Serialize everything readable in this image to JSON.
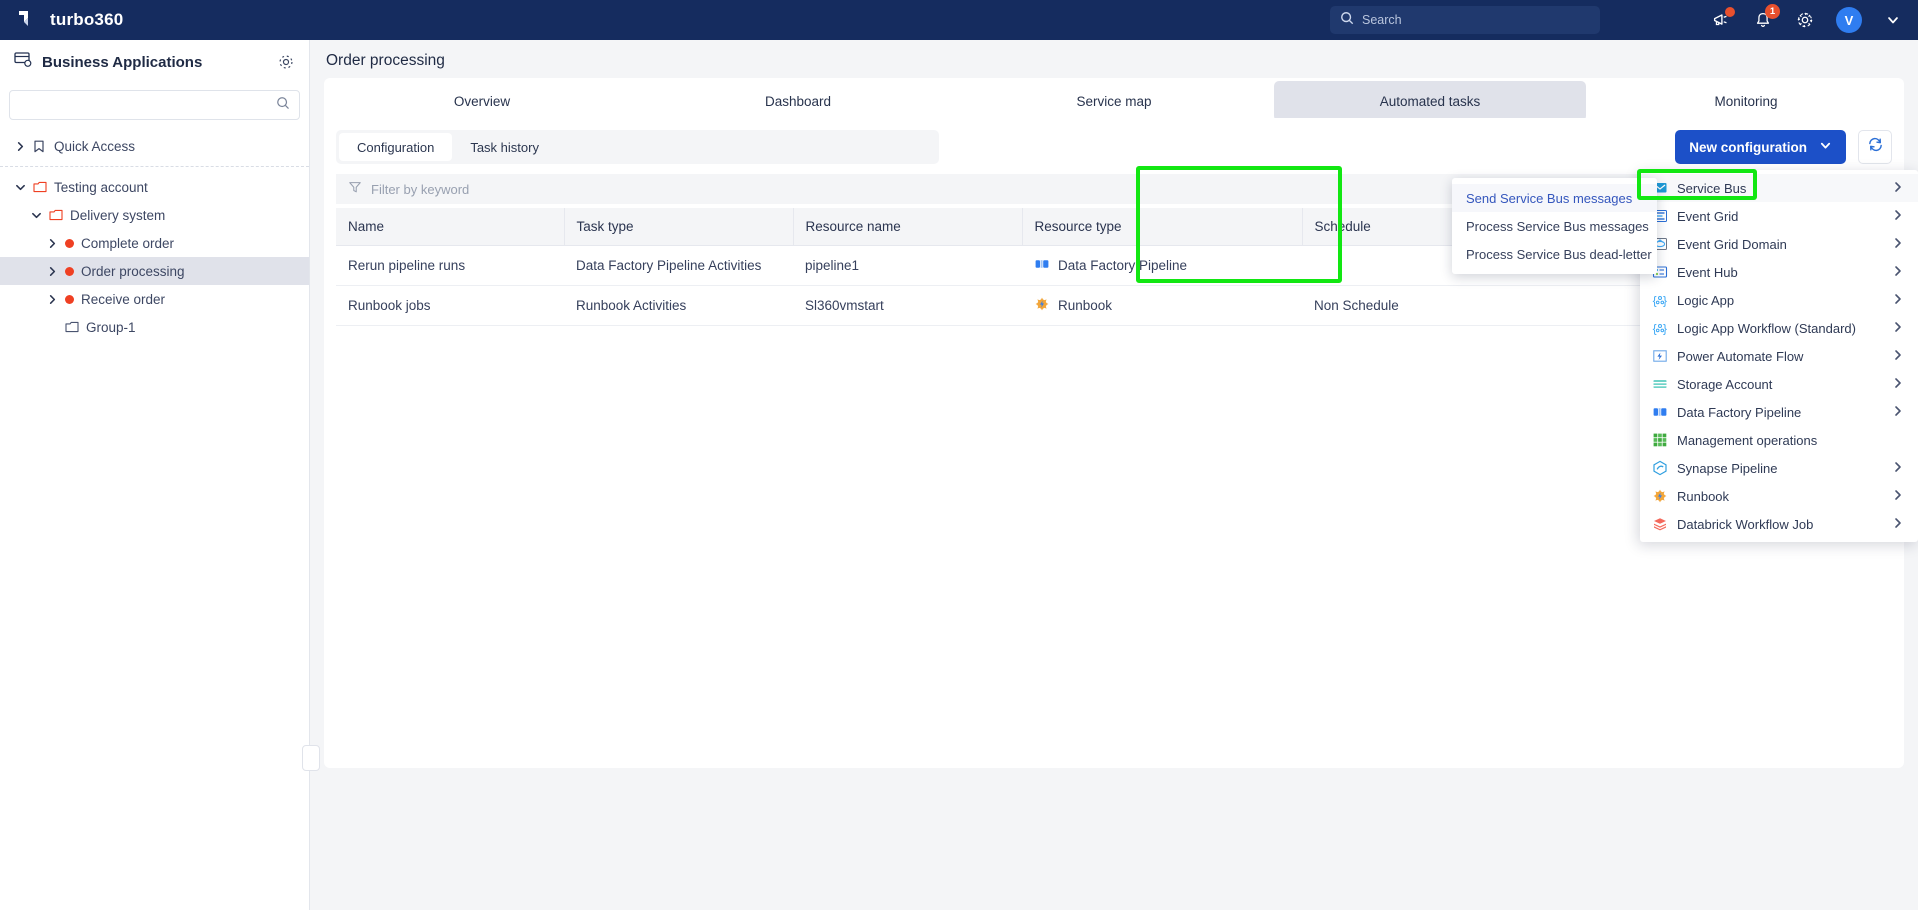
{
  "topbar": {
    "brand": "turbo360",
    "search_placeholder": "Search",
    "search_value": "",
    "icons": {
      "announce": "megaphone-icon",
      "bell": "bell-icon",
      "gear": "gear-icon"
    },
    "notification_count": "1",
    "avatar_initial": "V"
  },
  "sidebar": {
    "title": "Business Applications",
    "search_placeholder": "",
    "search_value": "",
    "tree": [
      {
        "label": "Quick Access",
        "icon": "bookmark-icon",
        "depth": 0,
        "chevron": "right",
        "selected": false
      },
      {
        "label": "Testing account",
        "icon": "folder-icon",
        "depth": 0,
        "chevron": "down",
        "selected": false
      },
      {
        "label": "Delivery system",
        "icon": "folder-icon",
        "depth": 1,
        "chevron": "down",
        "selected": false
      },
      {
        "label": "Complete order",
        "icon": "status-dot",
        "depth": 2,
        "chevron": "right",
        "selected": false
      },
      {
        "label": "Order processing",
        "icon": "status-dot",
        "depth": 2,
        "chevron": "right",
        "selected": true
      },
      {
        "label": "Receive order",
        "icon": "status-dot",
        "depth": 2,
        "chevron": "right",
        "selected": false
      },
      {
        "label": "Group-1",
        "icon": "folder-icon",
        "depth": 2,
        "chevron": "none",
        "selected": false
      }
    ]
  },
  "main": {
    "page_title": "Order processing",
    "tabs": [
      {
        "label": "Overview",
        "active": false
      },
      {
        "label": "Dashboard",
        "active": false
      },
      {
        "label": "Service map",
        "active": false
      },
      {
        "label": "Automated tasks",
        "active": true
      },
      {
        "label": "Monitoring",
        "active": false
      }
    ],
    "subtabs": [
      {
        "label": "Configuration",
        "active": true
      },
      {
        "label": "Task history",
        "active": false
      }
    ],
    "new_configuration_label": "New configuration",
    "refresh_icon": "refresh-icon",
    "filter_placeholder": "Filter by keyword",
    "table": {
      "columns": [
        "Name",
        "Task type",
        "Resource name",
        "Resource type",
        "Schedule"
      ],
      "rows": [
        {
          "name": "Rerun pipeline runs",
          "task_type": "Data Factory Pipeline Activities",
          "resource_name": "pipeline1",
          "resource_type": "Data Factory Pipeline",
          "resource_icon": "data-factory-pipeline-icon",
          "schedule": ""
        },
        {
          "name": "Runbook jobs",
          "task_type": "Runbook Activities",
          "resource_name": "Sl360vmstart",
          "resource_type": "Runbook",
          "resource_icon": "runbook-icon",
          "schedule": "Non Schedule"
        }
      ]
    }
  },
  "context_menu": {
    "items": [
      {
        "label": "Send Service Bus messages",
        "highlighted": true
      },
      {
        "label": "Process Service Bus messages",
        "highlighted": false
      },
      {
        "label": "Process Service Bus dead-letter",
        "highlighted": false
      }
    ]
  },
  "resource_menu": {
    "items": [
      {
        "label": "Service Bus",
        "icon": "service-bus-icon",
        "chevron": true,
        "selected": true
      },
      {
        "label": "Event Grid",
        "icon": "event-grid-icon",
        "chevron": true,
        "selected": false
      },
      {
        "label": "Event Grid Domain",
        "icon": "event-grid-domain-icon",
        "chevron": true,
        "selected": false
      },
      {
        "label": "Event Hub",
        "icon": "event-hub-icon",
        "chevron": true,
        "selected": false
      },
      {
        "label": "Logic App",
        "icon": "logic-app-icon",
        "chevron": true,
        "selected": false
      },
      {
        "label": "Logic App Workflow (Standard)",
        "icon": "logic-app-workflow-icon",
        "chevron": true,
        "selected": false
      },
      {
        "label": "Power Automate Flow",
        "icon": "power-automate-flow-icon",
        "chevron": true,
        "selected": false
      },
      {
        "label": "Storage Account",
        "icon": "storage-account-icon",
        "chevron": true,
        "selected": false
      },
      {
        "label": "Data Factory Pipeline",
        "icon": "data-factory-pipeline-icon",
        "chevron": true,
        "selected": false
      },
      {
        "label": "Management operations",
        "icon": "management-operations-icon",
        "chevron": false,
        "selected": false
      },
      {
        "label": "Synapse Pipeline",
        "icon": "synapse-pipeline-icon",
        "chevron": true,
        "selected": false
      },
      {
        "label": "Runbook",
        "icon": "runbook-icon",
        "chevron": true,
        "selected": false
      },
      {
        "label": "Databrick Workflow Job",
        "icon": "databricks-icon",
        "chevron": true,
        "selected": false
      }
    ]
  },
  "colors": {
    "brand_navy": "#152c5f",
    "primary_blue": "#1c50c8",
    "status_red": "#ef4023",
    "highlight_green": "#12e712"
  }
}
